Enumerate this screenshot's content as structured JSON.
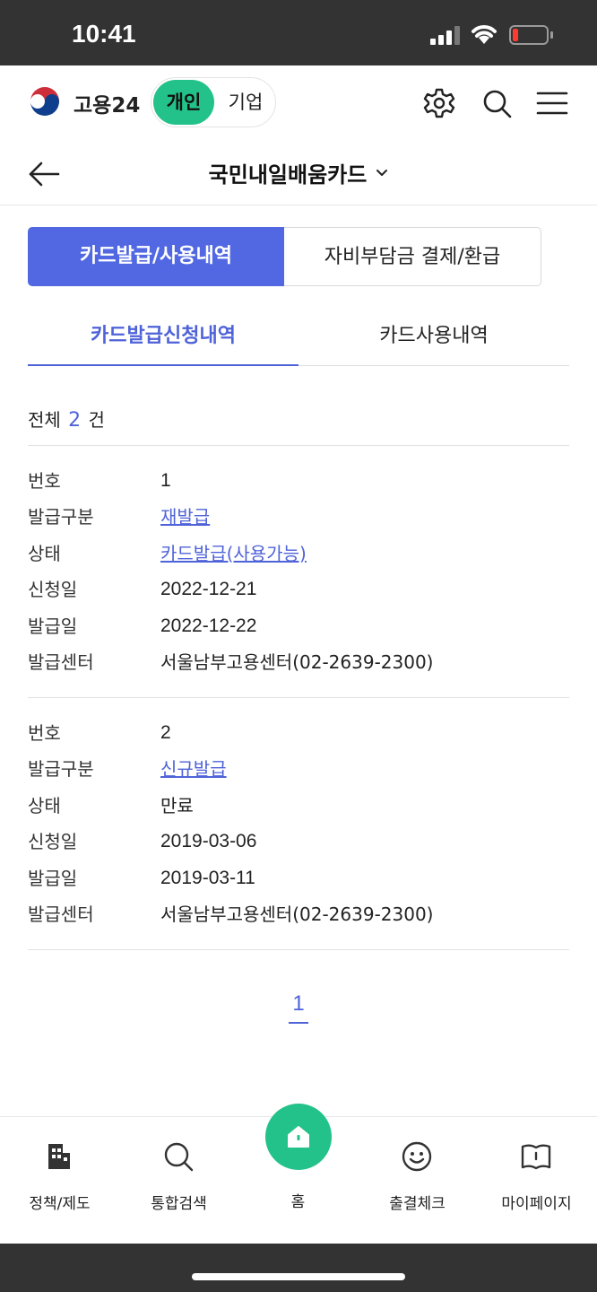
{
  "status_bar": {
    "time": "10:41"
  },
  "header": {
    "brand": "고용24",
    "toggle": {
      "active": "개인",
      "inactive": "기업"
    }
  },
  "title_bar": {
    "title": "국민내일배움카드"
  },
  "segment_tabs": [
    {
      "label": "카드발급/사용내역",
      "active": true
    },
    {
      "label": "자비부담금 결제/환급",
      "active": false
    }
  ],
  "sub_tabs": [
    {
      "label": "카드발급신청내역",
      "active": true
    },
    {
      "label": "카드사용내역",
      "active": false
    }
  ],
  "total": {
    "prefix": "전체",
    "count": "2",
    "suffix": "건"
  },
  "labels": {
    "number": "번호",
    "issue_type": "발급구분",
    "status": "상태",
    "apply_date": "신청일",
    "issue_date": "발급일",
    "center": "발급센터"
  },
  "records": [
    {
      "number": "1",
      "issue_type": "재발급",
      "status": "카드발급(사용가능)",
      "apply_date": "2022-12-21",
      "issue_date": "2022-12-22",
      "center": "서울남부고용센터(02-2639-2300)"
    },
    {
      "number": "2",
      "issue_type": "신규발급",
      "status": "만료",
      "apply_date": "2019-03-06",
      "issue_date": "2019-03-11",
      "center": "서울남부고용센터(02-2639-2300)"
    }
  ],
  "pagination": {
    "current": "1"
  },
  "bottom_nav": {
    "policy": "정책/제도",
    "search": "통합검색",
    "home": "홈",
    "attendance": "출결체크",
    "mypage": "마이페이지"
  },
  "colors": {
    "accent_blue": "#5168e2",
    "brand_green": "#23c28a",
    "link_blue": "#4f63d8"
  }
}
